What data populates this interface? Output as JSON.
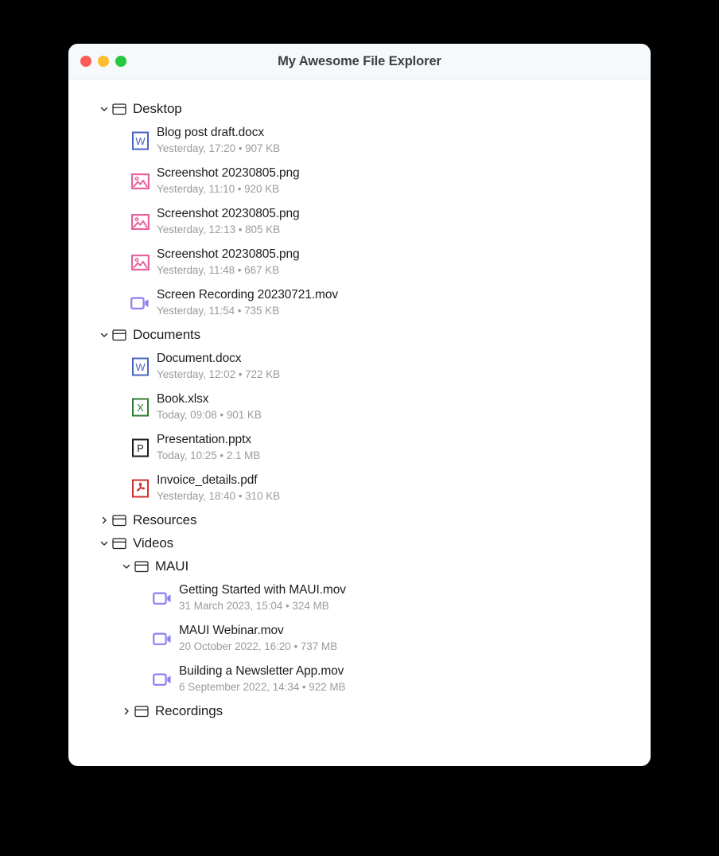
{
  "window": {
    "title": "My Awesome File Explorer",
    "traffic_lights": [
      {
        "name": "close-button",
        "color": "#fb5c55"
      },
      {
        "name": "minimize-button",
        "color": "#fdbc2e"
      },
      {
        "name": "maximize-button",
        "color": "#27c93f"
      }
    ]
  },
  "colors": {
    "page_background": "#000000",
    "window_background": "#ffffff",
    "titlebar_background": "#f6f9fb",
    "title_text": "#3c4043",
    "primary_text": "#1d1d1f",
    "meta_text": "#9b9b9e",
    "word_icon": "#4a66c4",
    "excel_icon": "#2f7d32",
    "powerpoint_icon": "#1d1d1f",
    "pdf_icon": "#d32f2f",
    "image_icon": "#e8629f",
    "video_icon": "#8b7ff0"
  },
  "tree": [
    {
      "type": "folder",
      "name": "Desktop",
      "depth": 0,
      "expanded": true,
      "chevron": "chevron-down-icon"
    },
    {
      "type": "file",
      "name": "Blog post draft.docx",
      "meta": "Yesterday, 17:20 • 907 KB",
      "depth": 1,
      "icon": "word-document-icon"
    },
    {
      "type": "file",
      "name": "Screenshot 20230805.png",
      "meta": "Yesterday, 11:10 • 920 KB",
      "depth": 1,
      "icon": "image-file-icon"
    },
    {
      "type": "file",
      "name": "Screenshot 20230805.png",
      "meta": "Yesterday, 12:13 • 805 KB",
      "depth": 1,
      "icon": "image-file-icon"
    },
    {
      "type": "file",
      "name": "Screenshot 20230805.png",
      "meta": "Yesterday, 11:48 • 667 KB",
      "depth": 1,
      "icon": "image-file-icon"
    },
    {
      "type": "file",
      "name": "Screen Recording 20230721.mov",
      "meta": "Yesterday, 11:54 • 735 KB",
      "depth": 1,
      "icon": "video-file-icon"
    },
    {
      "type": "folder",
      "name": "Documents",
      "depth": 0,
      "expanded": true,
      "chevron": "chevron-down-icon"
    },
    {
      "type": "file",
      "name": "Document.docx",
      "meta": "Yesterday, 12:02 • 722 KB",
      "depth": 1,
      "icon": "word-document-icon"
    },
    {
      "type": "file",
      "name": "Book.xlsx",
      "meta": "Today, 09:08 • 901 KB",
      "depth": 1,
      "icon": "excel-spreadsheet-icon"
    },
    {
      "type": "file",
      "name": "Presentation.pptx",
      "meta": "Today, 10:25 • 2.1 MB",
      "depth": 1,
      "icon": "powerpoint-presentation-icon"
    },
    {
      "type": "file",
      "name": "Invoice_details.pdf",
      "meta": "Yesterday, 18:40 • 310 KB",
      "depth": 1,
      "icon": "pdf-file-icon"
    },
    {
      "type": "folder",
      "name": "Resources",
      "depth": 0,
      "expanded": false,
      "chevron": "chevron-right-icon"
    },
    {
      "type": "folder",
      "name": "Videos",
      "depth": 0,
      "expanded": true,
      "chevron": "chevron-down-icon"
    },
    {
      "type": "folder",
      "name": "MAUI",
      "depth": 1,
      "expanded": true,
      "chevron": "chevron-down-icon"
    },
    {
      "type": "file",
      "name": "Getting Started with MAUI.mov",
      "meta": "31 March 2023, 15:04 • 324 MB",
      "depth": 2,
      "icon": "video-file-icon"
    },
    {
      "type": "file",
      "name": "MAUI Webinar.mov",
      "meta": "20 October 2022, 16:20 • 737 MB",
      "depth": 2,
      "icon": "video-file-icon"
    },
    {
      "type": "file",
      "name": "Building a Newsletter App.mov",
      "meta": "6 September 2022, 14:34 • 922 MB",
      "depth": 2,
      "icon": "video-file-icon"
    },
    {
      "type": "folder",
      "name": "Recordings",
      "depth": 1,
      "expanded": false,
      "chevron": "chevron-right-icon"
    }
  ]
}
